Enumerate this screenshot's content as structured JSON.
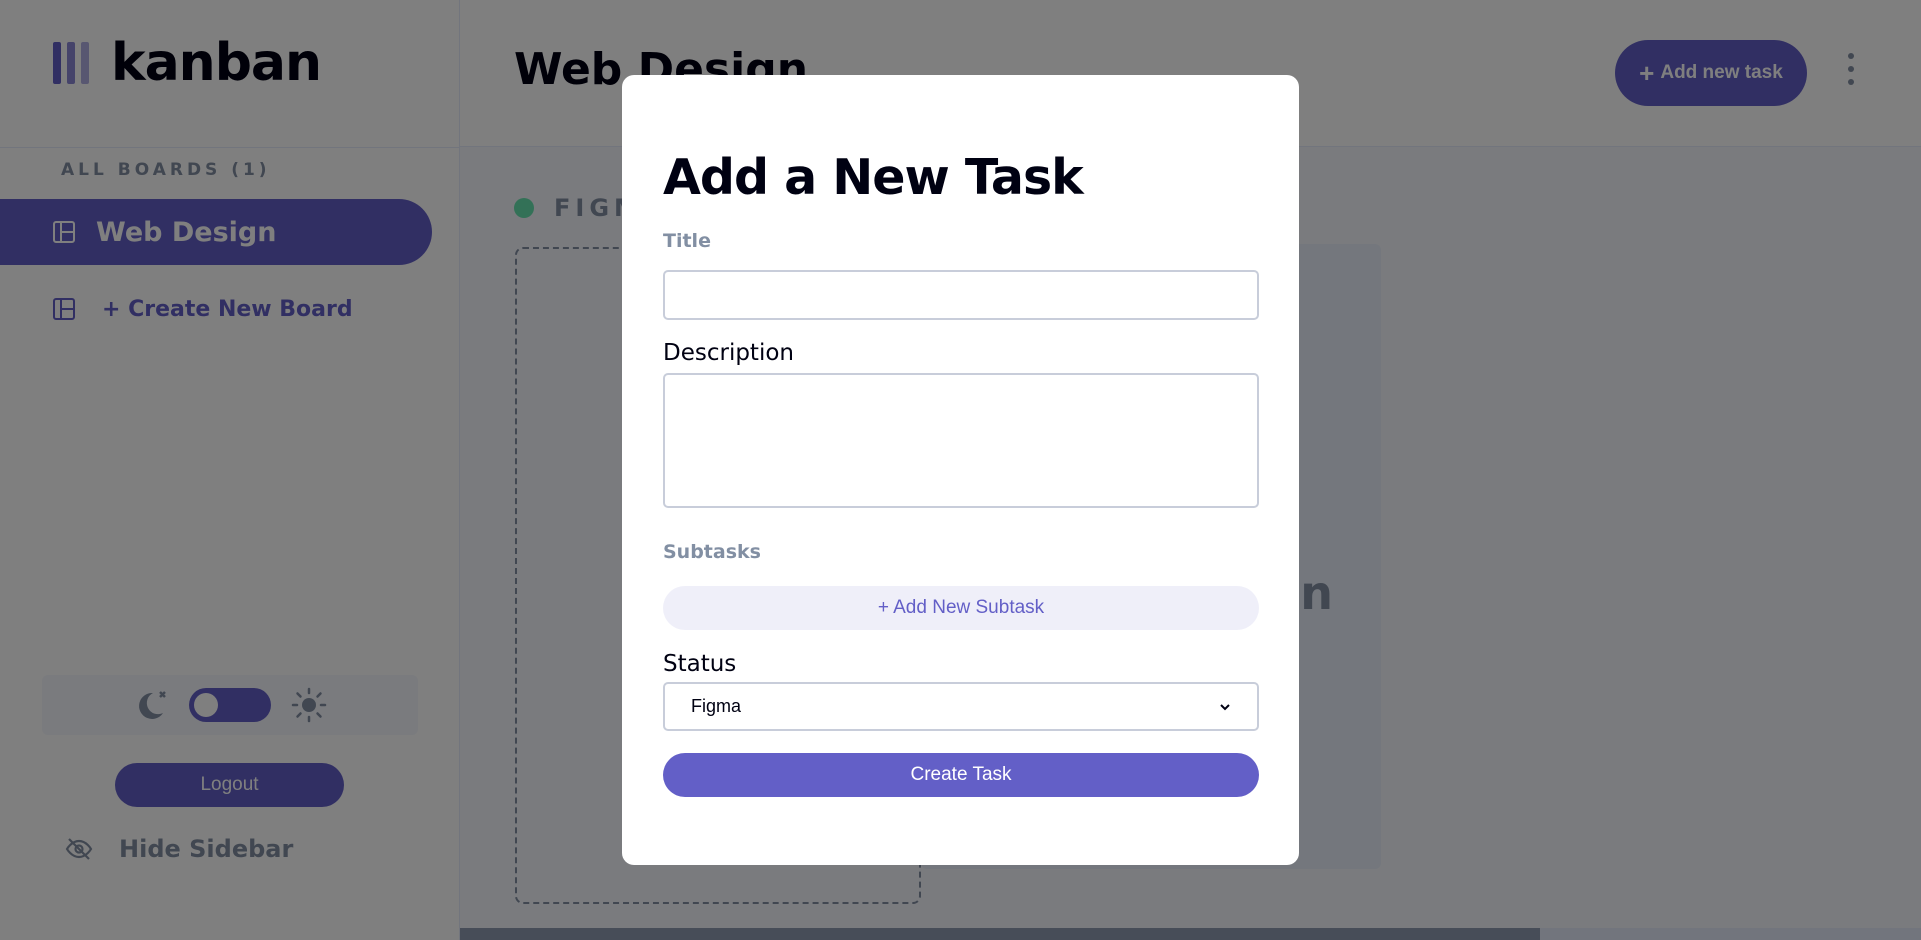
{
  "app": {
    "logo_text": "kanban"
  },
  "sidebar": {
    "all_boards_label": "ALL BOARDS (1)",
    "boards": [
      {
        "label": "Web Design",
        "active": true
      }
    ],
    "create_board_label": "+ Create New Board",
    "logout_label": "Logout",
    "hide_sidebar_label": "Hide Sidebar",
    "theme": {
      "mode": "light",
      "icons": [
        "moon-icon",
        "sun-icon"
      ]
    }
  },
  "header": {
    "board_title": "Web Design",
    "add_task_label": "Add new task",
    "add_task_icon": "plus-icon",
    "menu_icon": "kebab-menu-icon"
  },
  "board": {
    "columns": [
      {
        "name": "FIGMA",
        "dot_color": "#67E2AE"
      }
    ],
    "ghost_text": "an"
  },
  "modal": {
    "title": "Add a New Task",
    "title_label": "Title",
    "title_value": "",
    "description_label": "Description",
    "description_value": "",
    "subtasks_label": "Subtasks",
    "add_subtask_label": "+ Add New Subtask",
    "status_label": "Status",
    "status_value": "Figma",
    "create_label": "Create Task"
  },
  "colors": {
    "accent": "#635FC7",
    "accent_light": "#EFEFF9",
    "muted": "#828FA3",
    "column_dot": "#67E2AE"
  }
}
